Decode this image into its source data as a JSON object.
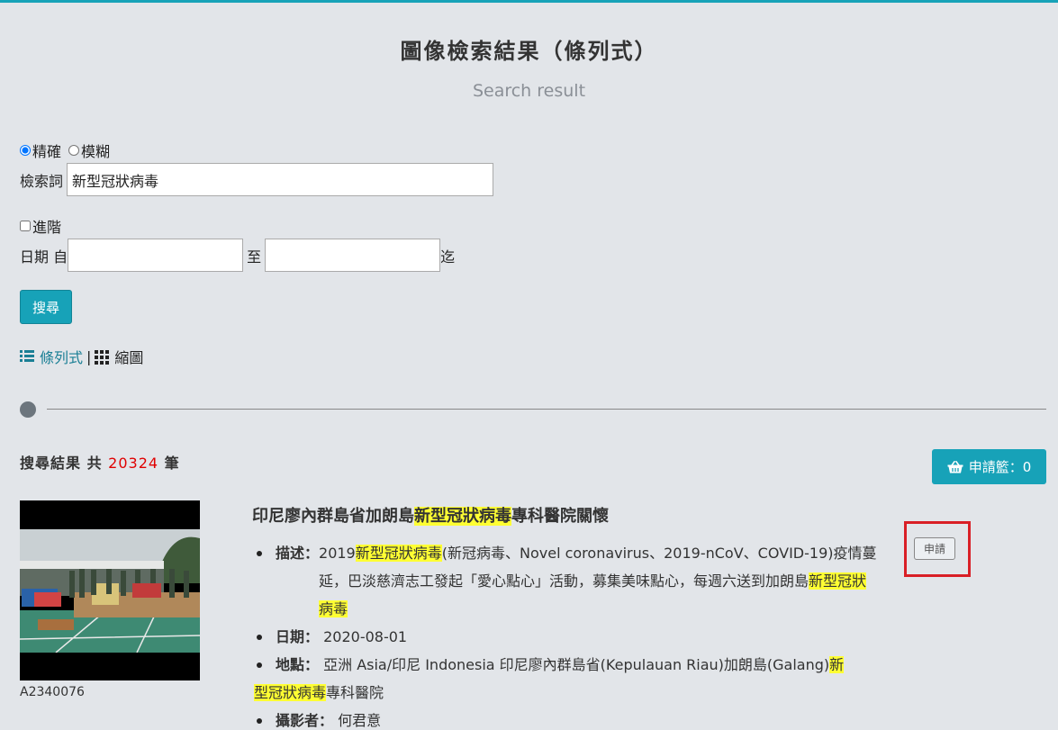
{
  "page": {
    "title": "圖像檢索結果（條列式）",
    "subtitle": "Search result"
  },
  "search": {
    "mode_exact": "精確",
    "mode_fuzzy": "模糊",
    "keyword_label": "檢索詞",
    "keyword_value": "新型冠狀病毒",
    "advanced_label": "進階",
    "date_label": "日期 自",
    "date_to": "至",
    "date_end": "迄",
    "search_button": "搜尋"
  },
  "view": {
    "list_label": "條列式",
    "sep": "|",
    "grid_label": "縮圖"
  },
  "results": {
    "prefix": "搜尋結果 共",
    "count": "20324",
    "suffix": "筆",
    "basket_label": "申請籃：0"
  },
  "item": {
    "id": "A2340076",
    "title_a": "印尼廖內群島省加朗島",
    "title_hl": "新型冠狀病毒",
    "title_b": "專科醫院關懷",
    "apply_label": "申請",
    "desc_key": "描述：",
    "desc_a": "2019",
    "desc_hl1": "新型冠狀病毒",
    "desc_b": "(新冠病毒、Novel coronavirus、2019-nCoV、COVID-19)疫情蔓延，巴淡慈濟志工發起「愛心點心」活動，募集美味點心，每週六送到加朗島",
    "desc_hl2": "新型冠狀病毒",
    "date_key": "日期：",
    "date_value": "2020-08-01",
    "loc_key": "地點：",
    "loc_a": "亞洲 Asia/印尼 Indonesia 印尼廖內群島省(Kepulauan Riau)加朗島(Galang)",
    "loc_hl_a": "新",
    "loc_hl_b": "型冠狀病毒",
    "loc_b": "專科醫院",
    "photographer_key": "攝影者：",
    "photographer_value": "何君意"
  },
  "colors": {
    "accent": "#17a2b8",
    "highlight": "#ffff33",
    "count": "#e00000",
    "box": "#d91f26"
  }
}
